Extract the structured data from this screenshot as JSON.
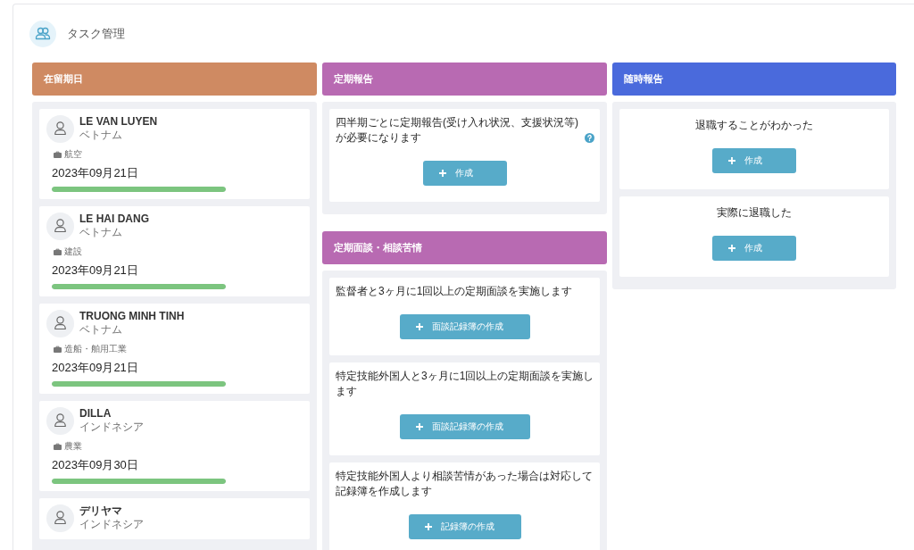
{
  "page": {
    "title": "タスク管理"
  },
  "columns": [
    {
      "sections": [
        {
          "kind": "workers",
          "title": "在留期日",
          "color": "#cf8a62",
          "workers": [
            {
              "name": "LE VAN LUYEN",
              "country": "ベトナム",
              "industry": "航空",
              "date": "2023年09月21日",
              "level": 1
            },
            {
              "name": "LE HAI DANG",
              "country": "ベトナム",
              "industry": "建設",
              "date": "2023年09月21日",
              "level": 1
            },
            {
              "name": "TRUONG MINH TINH",
              "country": "ベトナム",
              "industry": "造船・舶用工業",
              "date": "2023年09月21日",
              "level": 1
            },
            {
              "name": "DILLA",
              "country": "インドネシア",
              "industry": "農業",
              "date": "2023年09月30日",
              "level": 1
            },
            {
              "name": "デリヤマ",
              "country": "インドネシア"
            }
          ]
        }
      ]
    },
    {
      "sections": [
        {
          "kind": "report",
          "title": "定期報告",
          "color": "#b86ab2",
          "tasks": [
            {
              "text": "四半期ごとに定期報告(受け入れ状況、支援状況等)が必要になります",
              "help": true,
              "button": "作成"
            }
          ]
        },
        {
          "kind": "report",
          "title": "定期面談・相談苦情",
          "color": "#b86ab2",
          "tasks": [
            {
              "text": "監督者と3ヶ月に1回以上の定期面談を実施します",
              "help": false,
              "button": "面談記録簿の作成"
            },
            {
              "text": "特定技能外国人と3ヶ月に1回以上の定期面談を実施します",
              "help": false,
              "button": "面談記録簿の作成"
            },
            {
              "text": "特定技能外国人より相談苦情があった場合は対応して記録簿を作成します",
              "help": false,
              "button": "記録簿の作成"
            }
          ]
        }
      ]
    },
    {
      "sections": [
        {
          "kind": "event",
          "title": "随時報告",
          "color": "#4a6adc",
          "tasks": [
            {
              "text": "退職することがわかった",
              "help": false,
              "button": "作成"
            },
            {
              "text": "実際に退職した",
              "help": false,
              "button": "作成"
            }
          ]
        }
      ]
    }
  ]
}
